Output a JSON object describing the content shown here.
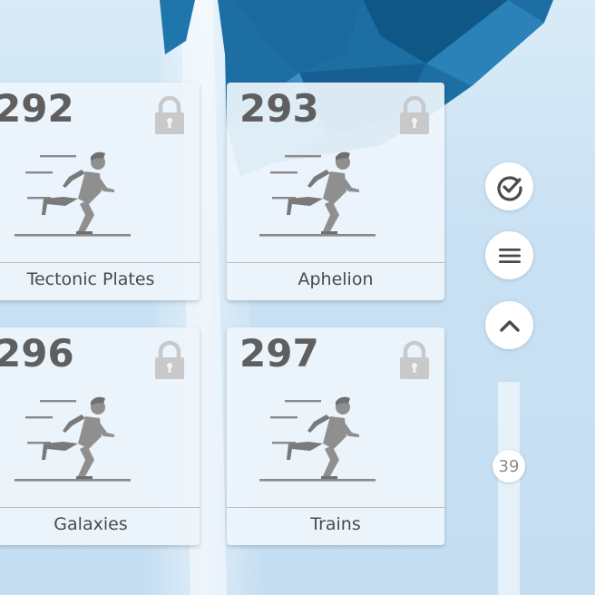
{
  "levels": [
    {
      "number": "292",
      "title": "Tectonic Plates",
      "locked": true
    },
    {
      "number": "293",
      "title": "Aphelion",
      "locked": true
    },
    {
      "number": "296",
      "title": "Galaxies",
      "locked": true
    },
    {
      "number": "297",
      "title": "Trains",
      "locked": true
    }
  ],
  "sidebar": {
    "check_icon": "check-circle-icon",
    "menu_icon": "menu-icon",
    "up_icon": "chevron-up-icon"
  },
  "scrollbar": {
    "position_label": "39"
  },
  "colors": {
    "card_bg": "#eef5fc",
    "number": "#5f5f5f",
    "icon_gray": "#8a8a8a",
    "background_blue": "#1a6aa0"
  }
}
